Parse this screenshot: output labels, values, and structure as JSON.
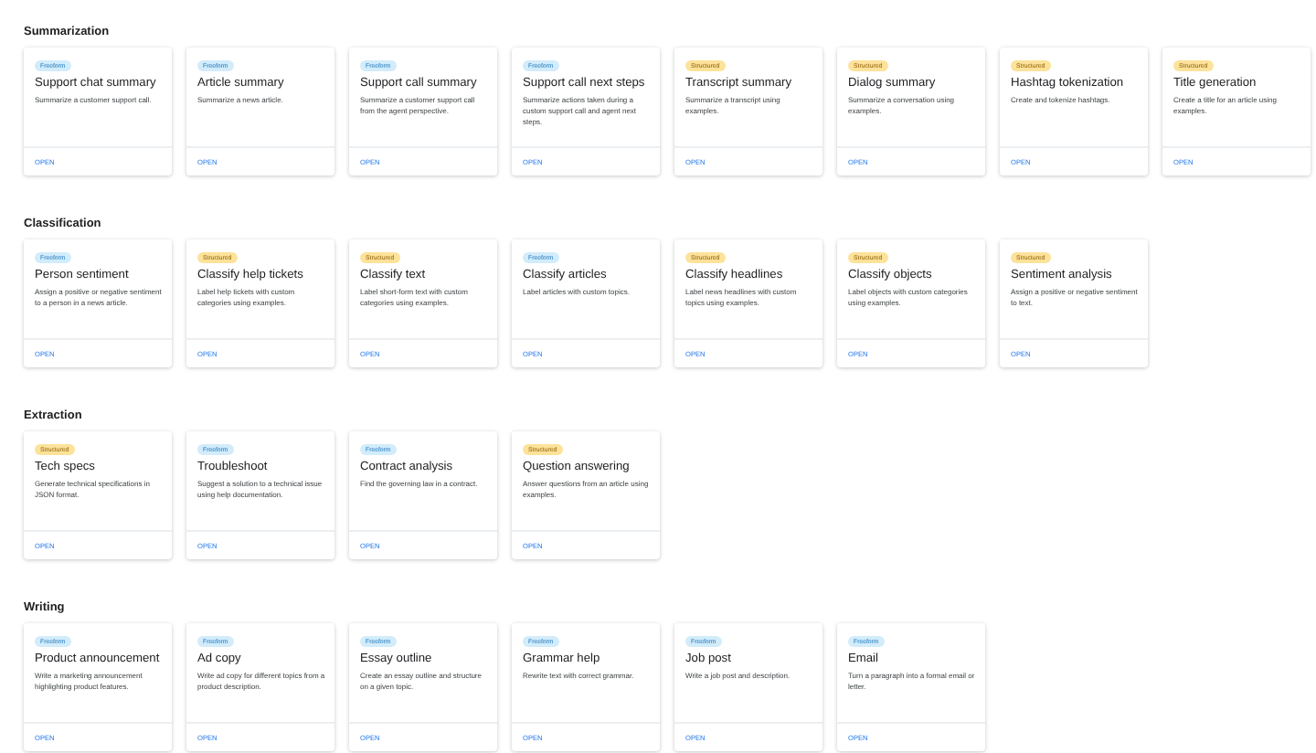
{
  "sections": [
    {
      "title": "Summarization",
      "cards": [
        {
          "tag": {
            "label": "Freeform",
            "kind": "freeform"
          },
          "title": "Support chat summary",
          "description": "Summarize a customer support call.",
          "action": "OPEN"
        },
        {
          "tag": {
            "label": "Freeform",
            "kind": "freeform"
          },
          "title": "Article summary",
          "description": "Summarize a news article.",
          "action": "OPEN"
        },
        {
          "tag": {
            "label": "Freeform",
            "kind": "freeform"
          },
          "title": "Support call summary",
          "description": "Summarize a customer support call from the agent perspective.",
          "action": "OPEN"
        },
        {
          "tag": {
            "label": "Freeform",
            "kind": "freeform"
          },
          "title": "Support call next steps",
          "description": "Summarize actions taken during a custom support call and agent next steps.",
          "action": "OPEN"
        },
        {
          "tag": {
            "label": "Structured",
            "kind": "structured"
          },
          "title": "Transcript summary",
          "description": "Summarize a transcript using examples.",
          "action": "OPEN"
        },
        {
          "tag": {
            "label": "Structured",
            "kind": "structured"
          },
          "title": "Dialog summary",
          "description": "Summarize a conversation using examples.",
          "action": "OPEN"
        },
        {
          "tag": {
            "label": "Structured",
            "kind": "structured"
          },
          "title": "Hashtag tokenization",
          "description": "Create and tokenize hashtags.",
          "action": "OPEN"
        },
        {
          "tag": {
            "label": "Structured",
            "kind": "structured"
          },
          "title": "Title generation",
          "description": "Create a title for an article using examples.",
          "action": "OPEN"
        }
      ]
    },
    {
      "title": "Classification",
      "cards": [
        {
          "tag": {
            "label": "Freeform",
            "kind": "freeform"
          },
          "title": "Person sentiment",
          "description": "Assign a positive or negative sentiment to a person in a news article.",
          "action": "OPEN"
        },
        {
          "tag": {
            "label": "Structured",
            "kind": "structured"
          },
          "title": "Classify help tickets",
          "description": "Label help tickets with custom categories using examples.",
          "action": "OPEN"
        },
        {
          "tag": {
            "label": "Structured",
            "kind": "structured"
          },
          "title": "Classify text",
          "description": "Label short-form text with custom categories using examples.",
          "action": "OPEN"
        },
        {
          "tag": {
            "label": "Freeform",
            "kind": "freeform"
          },
          "title": "Classify articles",
          "description": "Label articles with custom topics.",
          "action": "OPEN"
        },
        {
          "tag": {
            "label": "Structured",
            "kind": "structured"
          },
          "title": "Classify headlines",
          "description": "Label news headlines with custom topics using examples.",
          "action": "OPEN"
        },
        {
          "tag": {
            "label": "Structured",
            "kind": "structured"
          },
          "title": "Classify objects",
          "description": "Label objects with custom categories using examples.",
          "action": "OPEN"
        },
        {
          "tag": {
            "label": "Structured",
            "kind": "structured"
          },
          "title": "Sentiment analysis",
          "description": "Assign a positive or negative sentiment to text.",
          "action": "OPEN"
        }
      ]
    },
    {
      "title": "Extraction",
      "cards": [
        {
          "tag": {
            "label": "Structured",
            "kind": "structured"
          },
          "title": "Tech specs",
          "description": "Generate technical specifications in JSON format.",
          "action": "OPEN"
        },
        {
          "tag": {
            "label": "Freeform",
            "kind": "freeform"
          },
          "title": "Troubleshoot",
          "description": "Suggest a solution to a technical issue using help documentation.",
          "action": "OPEN"
        },
        {
          "tag": {
            "label": "Freeform",
            "kind": "freeform"
          },
          "title": "Contract analysis",
          "description": "Find the governing law in a contract.",
          "action": "OPEN"
        },
        {
          "tag": {
            "label": "Structured",
            "kind": "structured"
          },
          "title": "Question answering",
          "description": "Answer questions from an article using examples.",
          "action": "OPEN"
        }
      ]
    },
    {
      "title": "Writing",
      "cards": [
        {
          "tag": {
            "label": "Freeform",
            "kind": "freeform"
          },
          "title": "Product announcement",
          "description": "Write a marketing announcement highlighting product features.",
          "action": "OPEN"
        },
        {
          "tag": {
            "label": "Freeform",
            "kind": "freeform"
          },
          "title": "Ad copy",
          "description": "Write ad copy for different topics from a product description.",
          "action": "OPEN"
        },
        {
          "tag": {
            "label": "Freeform",
            "kind": "freeform"
          },
          "title": "Essay outline",
          "description": "Create an essay outline and structure on a given topic.",
          "action": "OPEN"
        },
        {
          "tag": {
            "label": "Freeform",
            "kind": "freeform"
          },
          "title": "Grammar help",
          "description": "Rewrite text with correct grammar.",
          "action": "OPEN"
        },
        {
          "tag": {
            "label": "Freeform",
            "kind": "freeform"
          },
          "title": "Job post",
          "description": "Write a job post and description.",
          "action": "OPEN"
        },
        {
          "tag": {
            "label": "Freeform",
            "kind": "freeform"
          },
          "title": "Email",
          "description": "Turn a paragraph into a formal email or letter.",
          "action": "OPEN"
        }
      ]
    }
  ]
}
